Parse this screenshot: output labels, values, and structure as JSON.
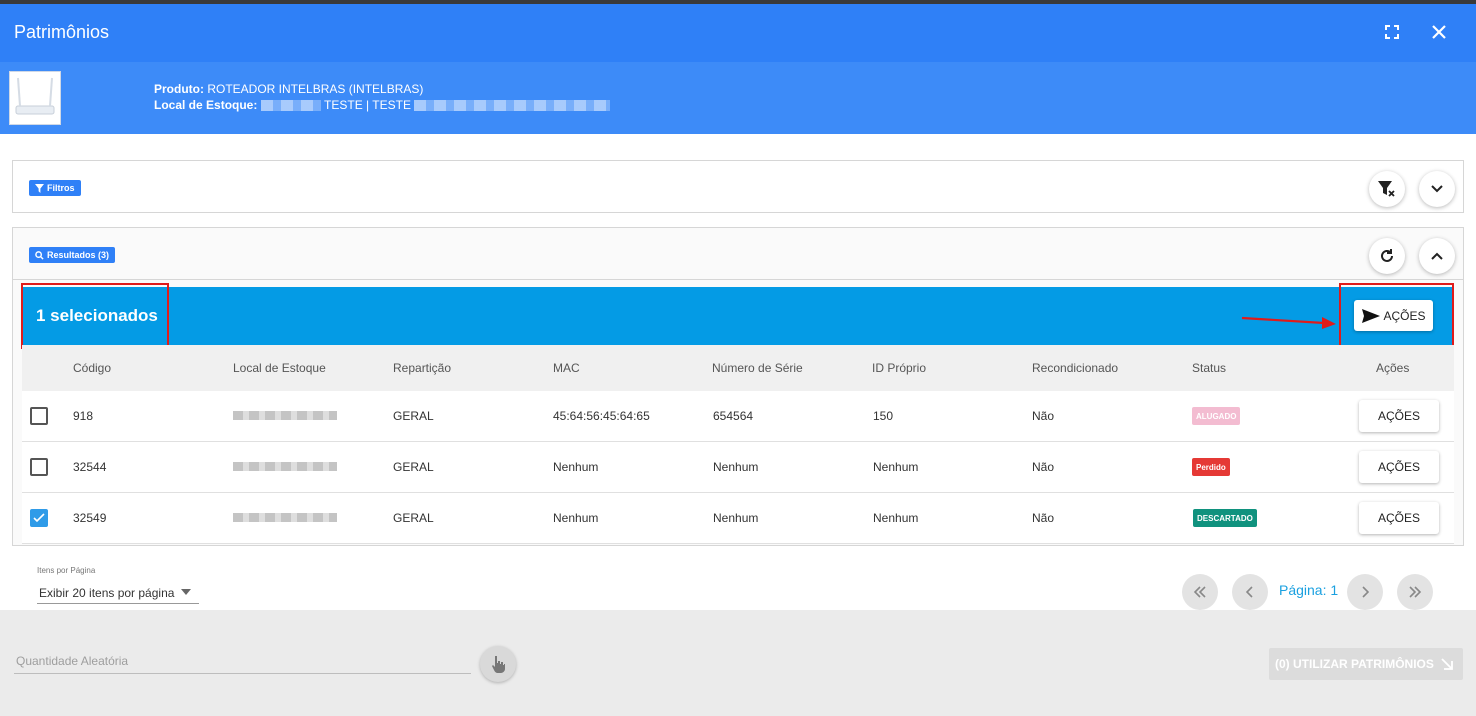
{
  "window": {
    "title": "Patrimônios"
  },
  "product": {
    "produto_label": "Produto:",
    "produto_value": "ROTEADOR INTELBRAS (INTELBRAS)",
    "local_label": "Local de Estoque:",
    "local_value": "TESTE | TESTE"
  },
  "filters": {
    "chip_label": "Filtros"
  },
  "results": {
    "chip_label": "Resultados (3)",
    "selected_text": "1 selecionados",
    "actions_label": "AÇÕES"
  },
  "table": {
    "columns": [
      "Código",
      "Local de Estoque",
      "Repartição",
      "MAC",
      "Número de Série",
      "ID Próprio",
      "Recondicionado",
      "Status",
      "Ações"
    ],
    "rows": [
      {
        "checked": false,
        "codigo": "918",
        "reparticao": "GERAL",
        "mac": "45:64:56:45:64:65",
        "serie": "654564",
        "id_proprio": "150",
        "recondicionado": "Não",
        "status": "ALUGADO",
        "status_color": "#f3bcd1",
        "acoes": "AÇÕES"
      },
      {
        "checked": false,
        "codigo": "32544",
        "reparticao": "GERAL",
        "mac": "Nenhum",
        "serie": "Nenhum",
        "id_proprio": "Nenhum",
        "recondicionado": "Não",
        "status": "Perdido",
        "status_color": "#e53935",
        "acoes": "AÇÕES"
      },
      {
        "checked": true,
        "codigo": "32549",
        "reparticao": "GERAL",
        "mac": "Nenhum",
        "serie": "Nenhum",
        "id_proprio": "Nenhum",
        "recondicionado": "Não",
        "status": "DESCARTADO",
        "status_color": "#10927e",
        "acoes": "AÇÕES"
      }
    ]
  },
  "pagination": {
    "items_label": "Itens por Página",
    "items_value": "Exibir 20 itens por página",
    "page_label": "Página: 1"
  },
  "footer": {
    "random_qty_placeholder": "Quantidade Aleatória",
    "use_button": "(0) UTILIZAR PATRIMÔNIOS"
  },
  "colors": {
    "header": "#2f80f7",
    "selbar": "#049be5",
    "highlight": "#e01b1b"
  }
}
